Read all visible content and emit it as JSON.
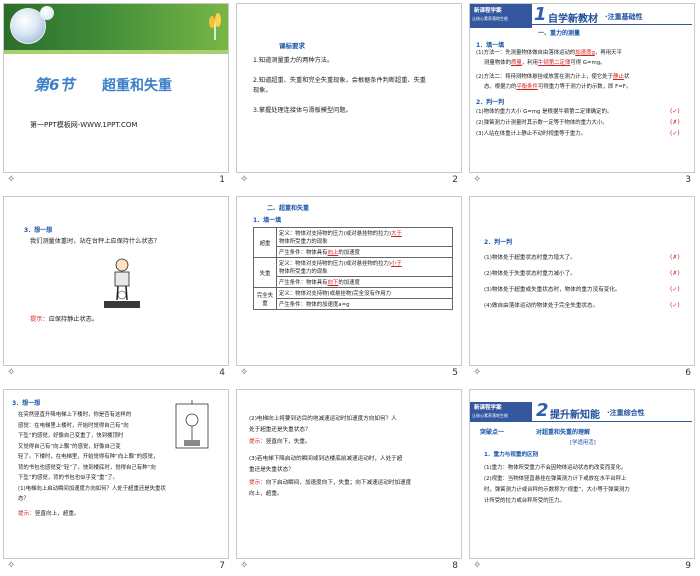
{
  "slide1": {
    "title_num": "第6节",
    "title_text": "超重和失重",
    "brand": "第一PPT模板网-WWW.1PPT.COM",
    "num": "1"
  },
  "slide2": {
    "heading": "课标要求",
    "items": [
      "1.知道测量重力的两种方法。",
      "2.知道超重、失重和完全失重现象，会根据条件判断超重、失重",
      "现象。",
      "3.掌握处理连接体与滑板模型问题。"
    ],
    "num": "2"
  },
  "slide3": {
    "badge_line1": "新课程学案",
    "badge_line2": "让核心素养落地生根",
    "big_num": "1",
    "title": "自学新教材",
    "subtitle": "·注重基础性",
    "sec1": "一、重力的测量",
    "fill_head": "1．填一填",
    "l1": "(1)方法一：先测量物体做自由落体运动的",
    "a1": "加速度g",
    "l1b": "，再用天平",
    "l2": "测量物体的",
    "a2": "质量",
    "l2b": "，利用",
    "a3": "牛顿第二定律",
    "l2c": "可得 G=mg。",
    "l3": "(2)方法二：将待测物体悬挂或放置在测力计上，使它处于",
    "a4": "静止",
    "l3b": "状",
    "l4": "态。根据力的",
    "a5": "平衡条件",
    "l4b": "可得重力等于测力计的示数，即 F=F。",
    "judge_head": "2．判一判",
    "j1": "(1)物体的重力大小 G=mg 是根据牛顿第二定律确定的。",
    "m1": "(✓)",
    "j2": "(2)弹簧测力计测量时其示数一定等于物体的重力大小。",
    "m2": "(✗)",
    "j3": "(3)人站在体重计上静止不动时视重等于重力。",
    "m3": "(✓)",
    "num": "3"
  },
  "slide4": {
    "head": "3．想一想",
    "q": "我们测量体重时，站在台秤上应保持什么状态？",
    "tip_label": "提示：",
    "tip": "应保持静止状态。",
    "num": "4"
  },
  "slide5": {
    "sec": "二、超重和失重",
    "fill": "1．填一填",
    "rows": [
      {
        "label": "超重",
        "def": "定义：物体对支持物的压力(或对悬挂物的拉力)",
        "ans": "大于",
        "def2": "物体所受重力的现象",
        "cond": "产生条件：物体具有",
        "dir": "向上",
        "cond2": "的加速度"
      },
      {
        "label": "失重",
        "def": "定义：物体对支持物的压力(或对悬挂物的拉力)",
        "ans": "小于",
        "def2": "物体所受重力的现象",
        "cond": "产生条件：物体具有",
        "dir": "向下",
        "cond2": "的加速度"
      },
      {
        "label": "完全失重",
        "def": "定义：物体对支持物(或悬挂物)完全没有作用力",
        "cond": "产生条件：物体的加速度a=g"
      }
    ],
    "num": "5"
  },
  "slide6": {
    "head": "2．判一判",
    "items": [
      {
        "q": "(1)物体处于超重状态时重力增大了。",
        "m": "(✗)"
      },
      {
        "q": "(2)物体处于失重状态时重力减小了。",
        "m": "(✗)"
      },
      {
        "q": "(3)物体处于超重或失重状态时，物体的重力没有变化。",
        "m": "(✓)"
      },
      {
        "q": "(4)做自由落体运动的物体处于完全失重状态。",
        "m": "(✓)"
      }
    ],
    "num": "6"
  },
  "slide7": {
    "head": "3．想一想",
    "lines": [
      "在突然竖直升降电梯上下楼时，你是否有这样的",
      "感觉：在电梯里上楼时，开始时觉得自己有“向",
      "下坠”的感觉，好像自己变重了，快到楼顶时",
      "又觉得自己有“向上飘”的感觉，好像自己变",
      "轻了。下楼时，在电梯里，开始觉得有种“向上飘”的感觉，",
      "背的书包也感觉变“轻”了。快到楼底时，觉得自己有种“向",
      "下坠”的感觉，背的书包也似乎变“重”了。",
      "(1)电梯向上启动瞬间加速度方向如何？人处于超重还是失重状",
      "态？"
    ],
    "tip_label": "提示：",
    "tip": "竖直向上，超重。",
    "num": "7"
  },
  "slide8": {
    "q2": "(2)电梯向上将要到达目的地减速运动时加速度方向如何？人",
    "q2b": "处于超重还是失重状态？",
    "tip_label": "提示：",
    "t2": "竖直向下，失重。",
    "q3": "(3)若电梯下降启动的瞬间或到达楼底前减速运动时，人处于超",
    "q3b": "重还是失重状态？",
    "t3": "向下启动瞬间，加速度向下，失重；向下减速运动时加速度",
    "t3b": "向上，超重。",
    "num": "8"
  },
  "slide9": {
    "badge_line1": "新课程学案",
    "badge_line2": "让核心素养落地生根",
    "big_num": "2",
    "title": "提升新知能",
    "subtitle": "·注重综合性",
    "point": "突破点一",
    "point_title": "对超重和失重的理解",
    "tag": "[学透用活]",
    "sub1": "1．重力与视重的区别",
    "l1": "(1)重力：物体所受重力不会因物体运动状态的改变而变化。",
    "l2": "(2)视重：当物体竖直悬挂在弹簧测力计下或放在水平台秤上",
    "l3": "时，弹簧测力计或台秤的示数称为“视重”，大小等于弹簧测力",
    "l4": "计所受的拉力或台秤所受的压力。",
    "num": "9"
  }
}
